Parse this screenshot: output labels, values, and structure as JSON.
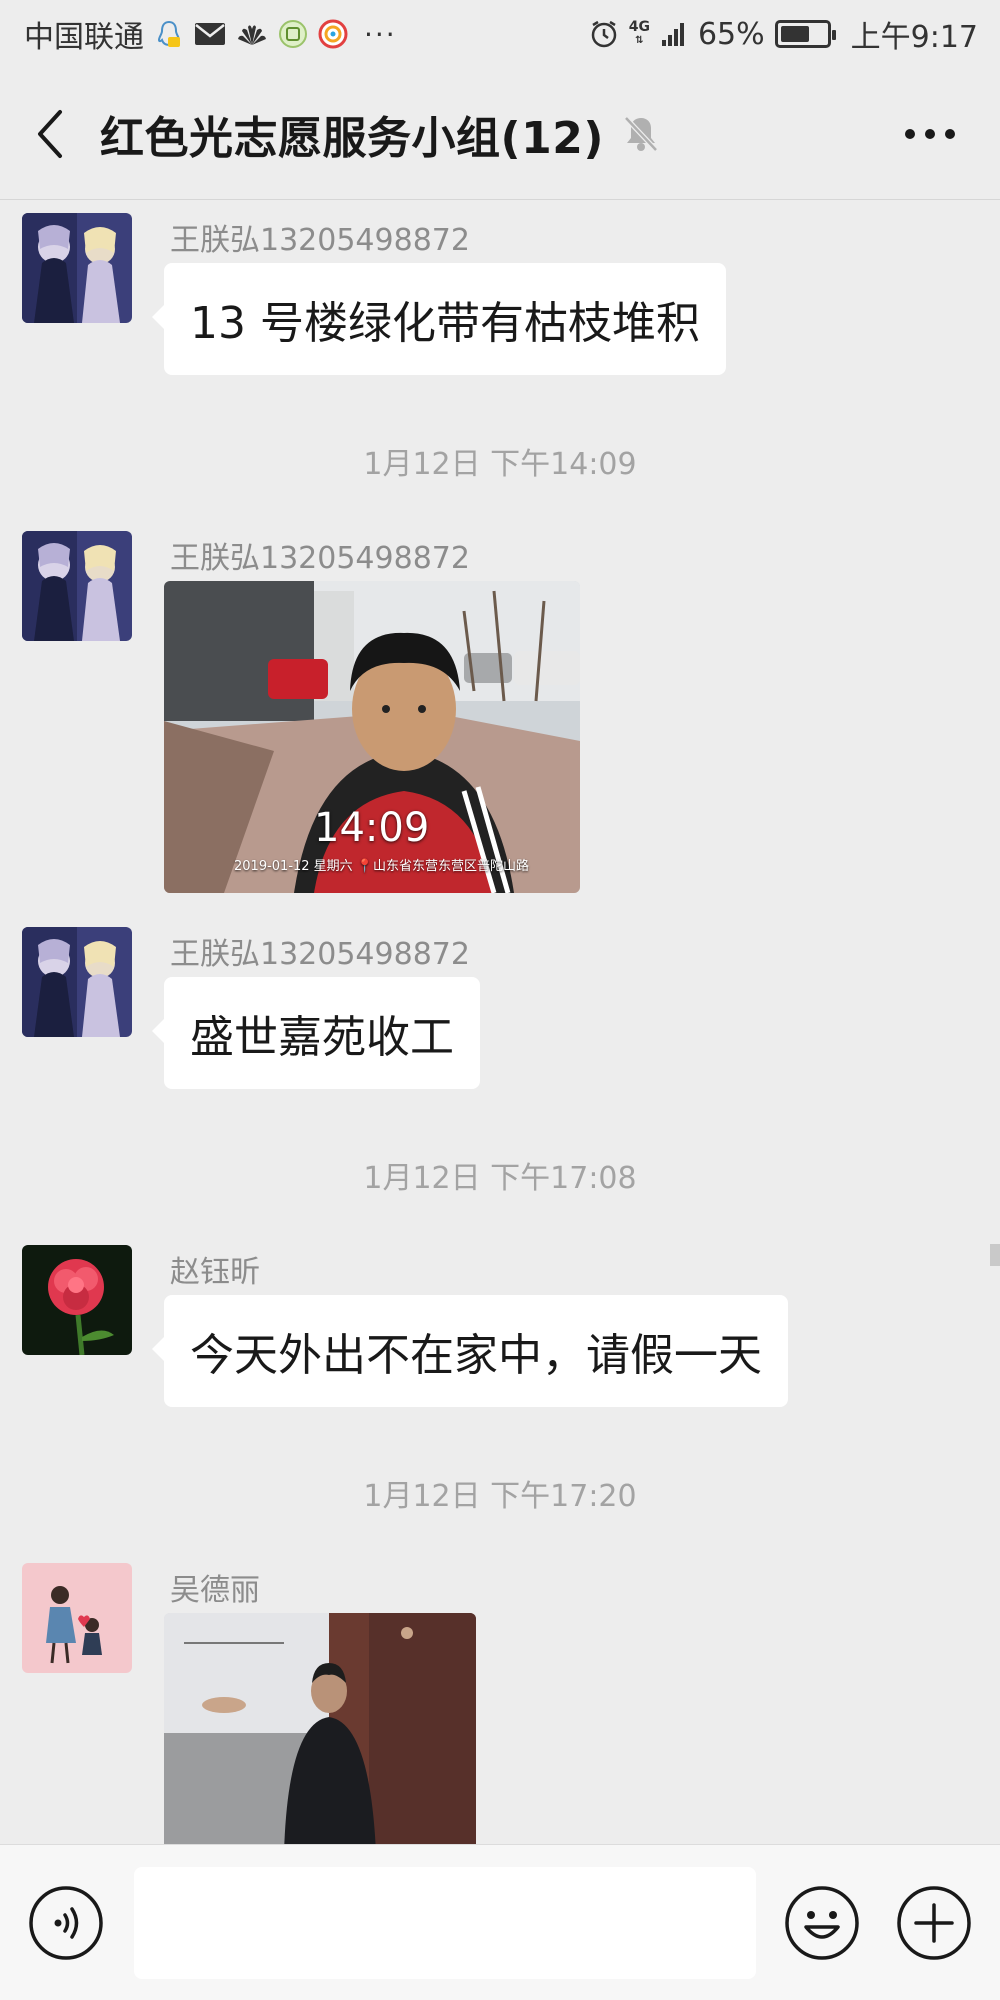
{
  "status_bar": {
    "carrier": "中国联通",
    "notification_icons": [
      "qq-icon",
      "mail-icon",
      "huawei-icon",
      "app-icon",
      "weibo-icon"
    ],
    "more": "···",
    "network": "4G",
    "battery_percent": "65%",
    "battery_level": 0.65,
    "time": "上午9:17"
  },
  "header": {
    "title": "红色光志愿服务小组(12)",
    "muted": true
  },
  "messages": [
    {
      "type": "text",
      "sender": "王朕弘13205498872",
      "text": "13 号楼绿化带有枯枝堆积",
      "avatar": "anime-avatar"
    },
    {
      "type": "timestamp",
      "text": "1月12日 下午14:09"
    },
    {
      "type": "image",
      "sender": "王朕弘13205498872",
      "avatar": "anime-avatar",
      "overlay_time": "14:09",
      "overlay_caption": "2019-01-12 星期六 📍山东省东营东营区普陀山路"
    },
    {
      "type": "text",
      "sender": "王朕弘13205498872",
      "text": "盛世嘉苑收工",
      "avatar": "anime-avatar"
    },
    {
      "type": "timestamp",
      "text": "1月12日 下午17:08"
    },
    {
      "type": "text",
      "sender": "赵钰昕",
      "text": "今天外出不在家中，请假一天",
      "avatar": "flower-avatar"
    },
    {
      "type": "timestamp",
      "text": "1月12日 下午17:20"
    },
    {
      "type": "image",
      "sender": "吴德丽",
      "avatar": "couple-avatar"
    }
  ],
  "input": {
    "value": "",
    "placeholder": ""
  },
  "colors": {
    "background": "#ededed",
    "bubble": "#ffffff",
    "sender_text": "#8c8c8c",
    "timestamp_text": "#a3a3a3"
  }
}
